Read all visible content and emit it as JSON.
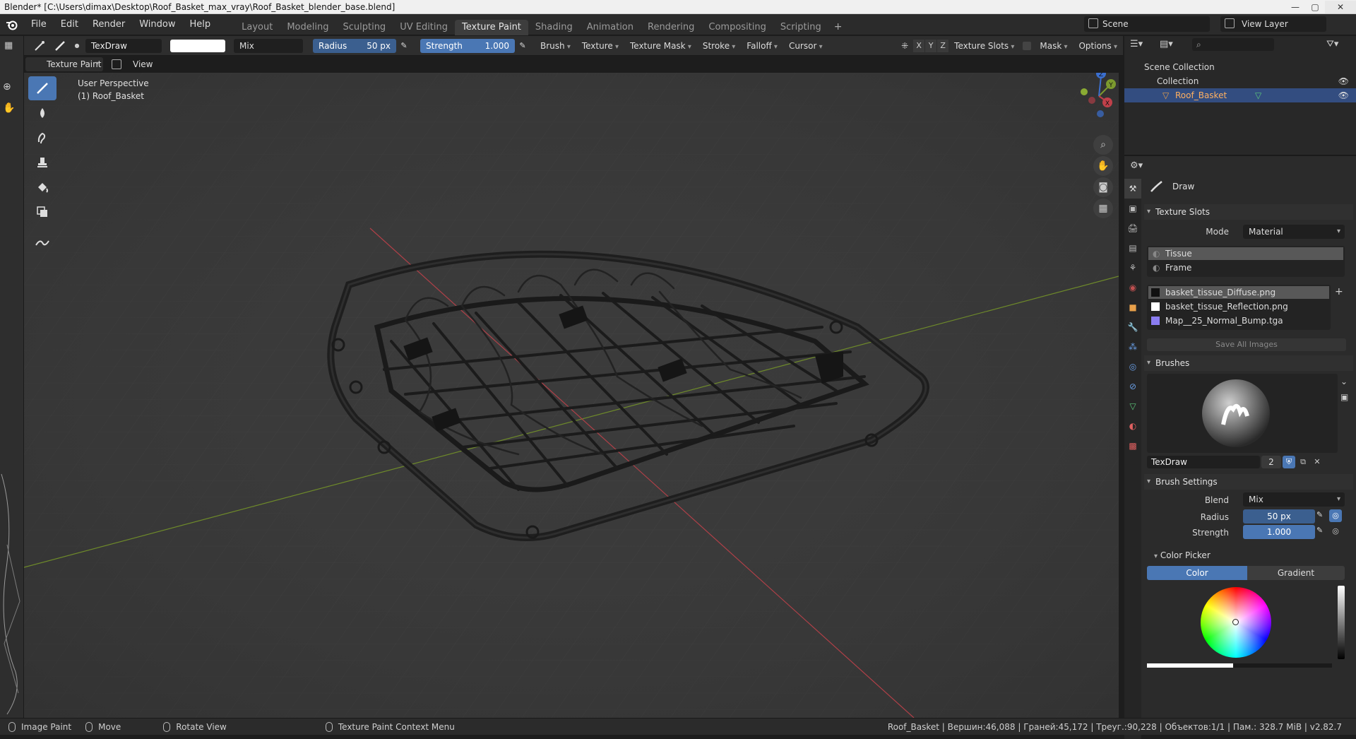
{
  "window": {
    "title": "Blender* [C:\\Users\\dimax\\Desktop\\Roof_Basket_max_vray\\Roof_Basket_blender_base.blend]",
    "minimize": "—",
    "maximize": "▢",
    "close": "✕"
  },
  "menu": [
    "File",
    "Edit",
    "Render",
    "Window",
    "Help"
  ],
  "workspaces": [
    {
      "label": "Layout",
      "active": false
    },
    {
      "label": "Modeling",
      "active": false
    },
    {
      "label": "Sculpting",
      "active": false
    },
    {
      "label": "UV Editing",
      "active": false
    },
    {
      "label": "Texture Paint",
      "active": true
    },
    {
      "label": "Shading",
      "active": false
    },
    {
      "label": "Animation",
      "active": false
    },
    {
      "label": "Rendering",
      "active": false
    },
    {
      "label": "Compositing",
      "active": false
    },
    {
      "label": "Scripting",
      "active": false
    }
  ],
  "workspace_add": "+",
  "scene": "Scene",
  "view_layer": "View Layer",
  "tool_header": {
    "brush_name": "TexDraw",
    "blend": "Mix",
    "radius_label": "Radius",
    "radius_value": "50 px",
    "strength_label": "Strength",
    "strength_value": "1.000",
    "dropdowns": [
      "Brush",
      "Texture",
      "Texture Mask",
      "Stroke",
      "Falloff",
      "Cursor"
    ],
    "axes": [
      "X",
      "Y",
      "Z"
    ],
    "right_dropdowns": [
      "Texture Slots",
      "Mask",
      "Options"
    ]
  },
  "mode_row": {
    "mode": "Texture Paint",
    "view": "View"
  },
  "viewport": {
    "perspective": "User Perspective",
    "object": "(1) Roof_Basket",
    "gizmo": {
      "x": "X",
      "y": "Y",
      "z": "Z"
    }
  },
  "outliner": {
    "scene_collection": "Scene Collection",
    "collection": "Collection",
    "object": "Roof_Basket"
  },
  "properties": {
    "tool_name": "Draw",
    "texture_slots_header": "Texture Slots",
    "mode_label": "Mode",
    "mode_value": "Material",
    "materials": [
      "Tissue",
      "Frame"
    ],
    "images": [
      "basket_tissue_Diffuse.png",
      "basket_tissue_Reflection.png",
      "Map__25_Normal_Bump.tga"
    ],
    "save_all": "Save All Images",
    "brushes_header": "Brushes",
    "brush_name": "TexDraw",
    "brush_users": "2",
    "brush_settings_header": "Brush Settings",
    "blend_label": "Blend",
    "blend_value": "Mix",
    "radius_label": "Radius",
    "radius_value": "50 px",
    "strength_label": "Strength",
    "strength_value": "1.000",
    "color_picker_header": "Color Picker",
    "color_tab": "Color",
    "gradient_tab": "Gradient"
  },
  "statusbar": {
    "image_paint": "Image Paint",
    "move": "Move",
    "rotate_view": "Rotate View",
    "context_menu": "Texture Paint Context Menu",
    "stats": "Roof_Basket | Вершин:46,088 | Граней:45,172 | Треуг.:90,228 | Объектов:1/1 | Пам.: 328.7 MiB | v2.82.7"
  },
  "colors": {
    "accent": "#4a77b4",
    "selection": "#334d80",
    "viewport_bg": "#3b3b3b",
    "x_axis": "#c0404a",
    "y_axis": "#7c9a2e"
  }
}
